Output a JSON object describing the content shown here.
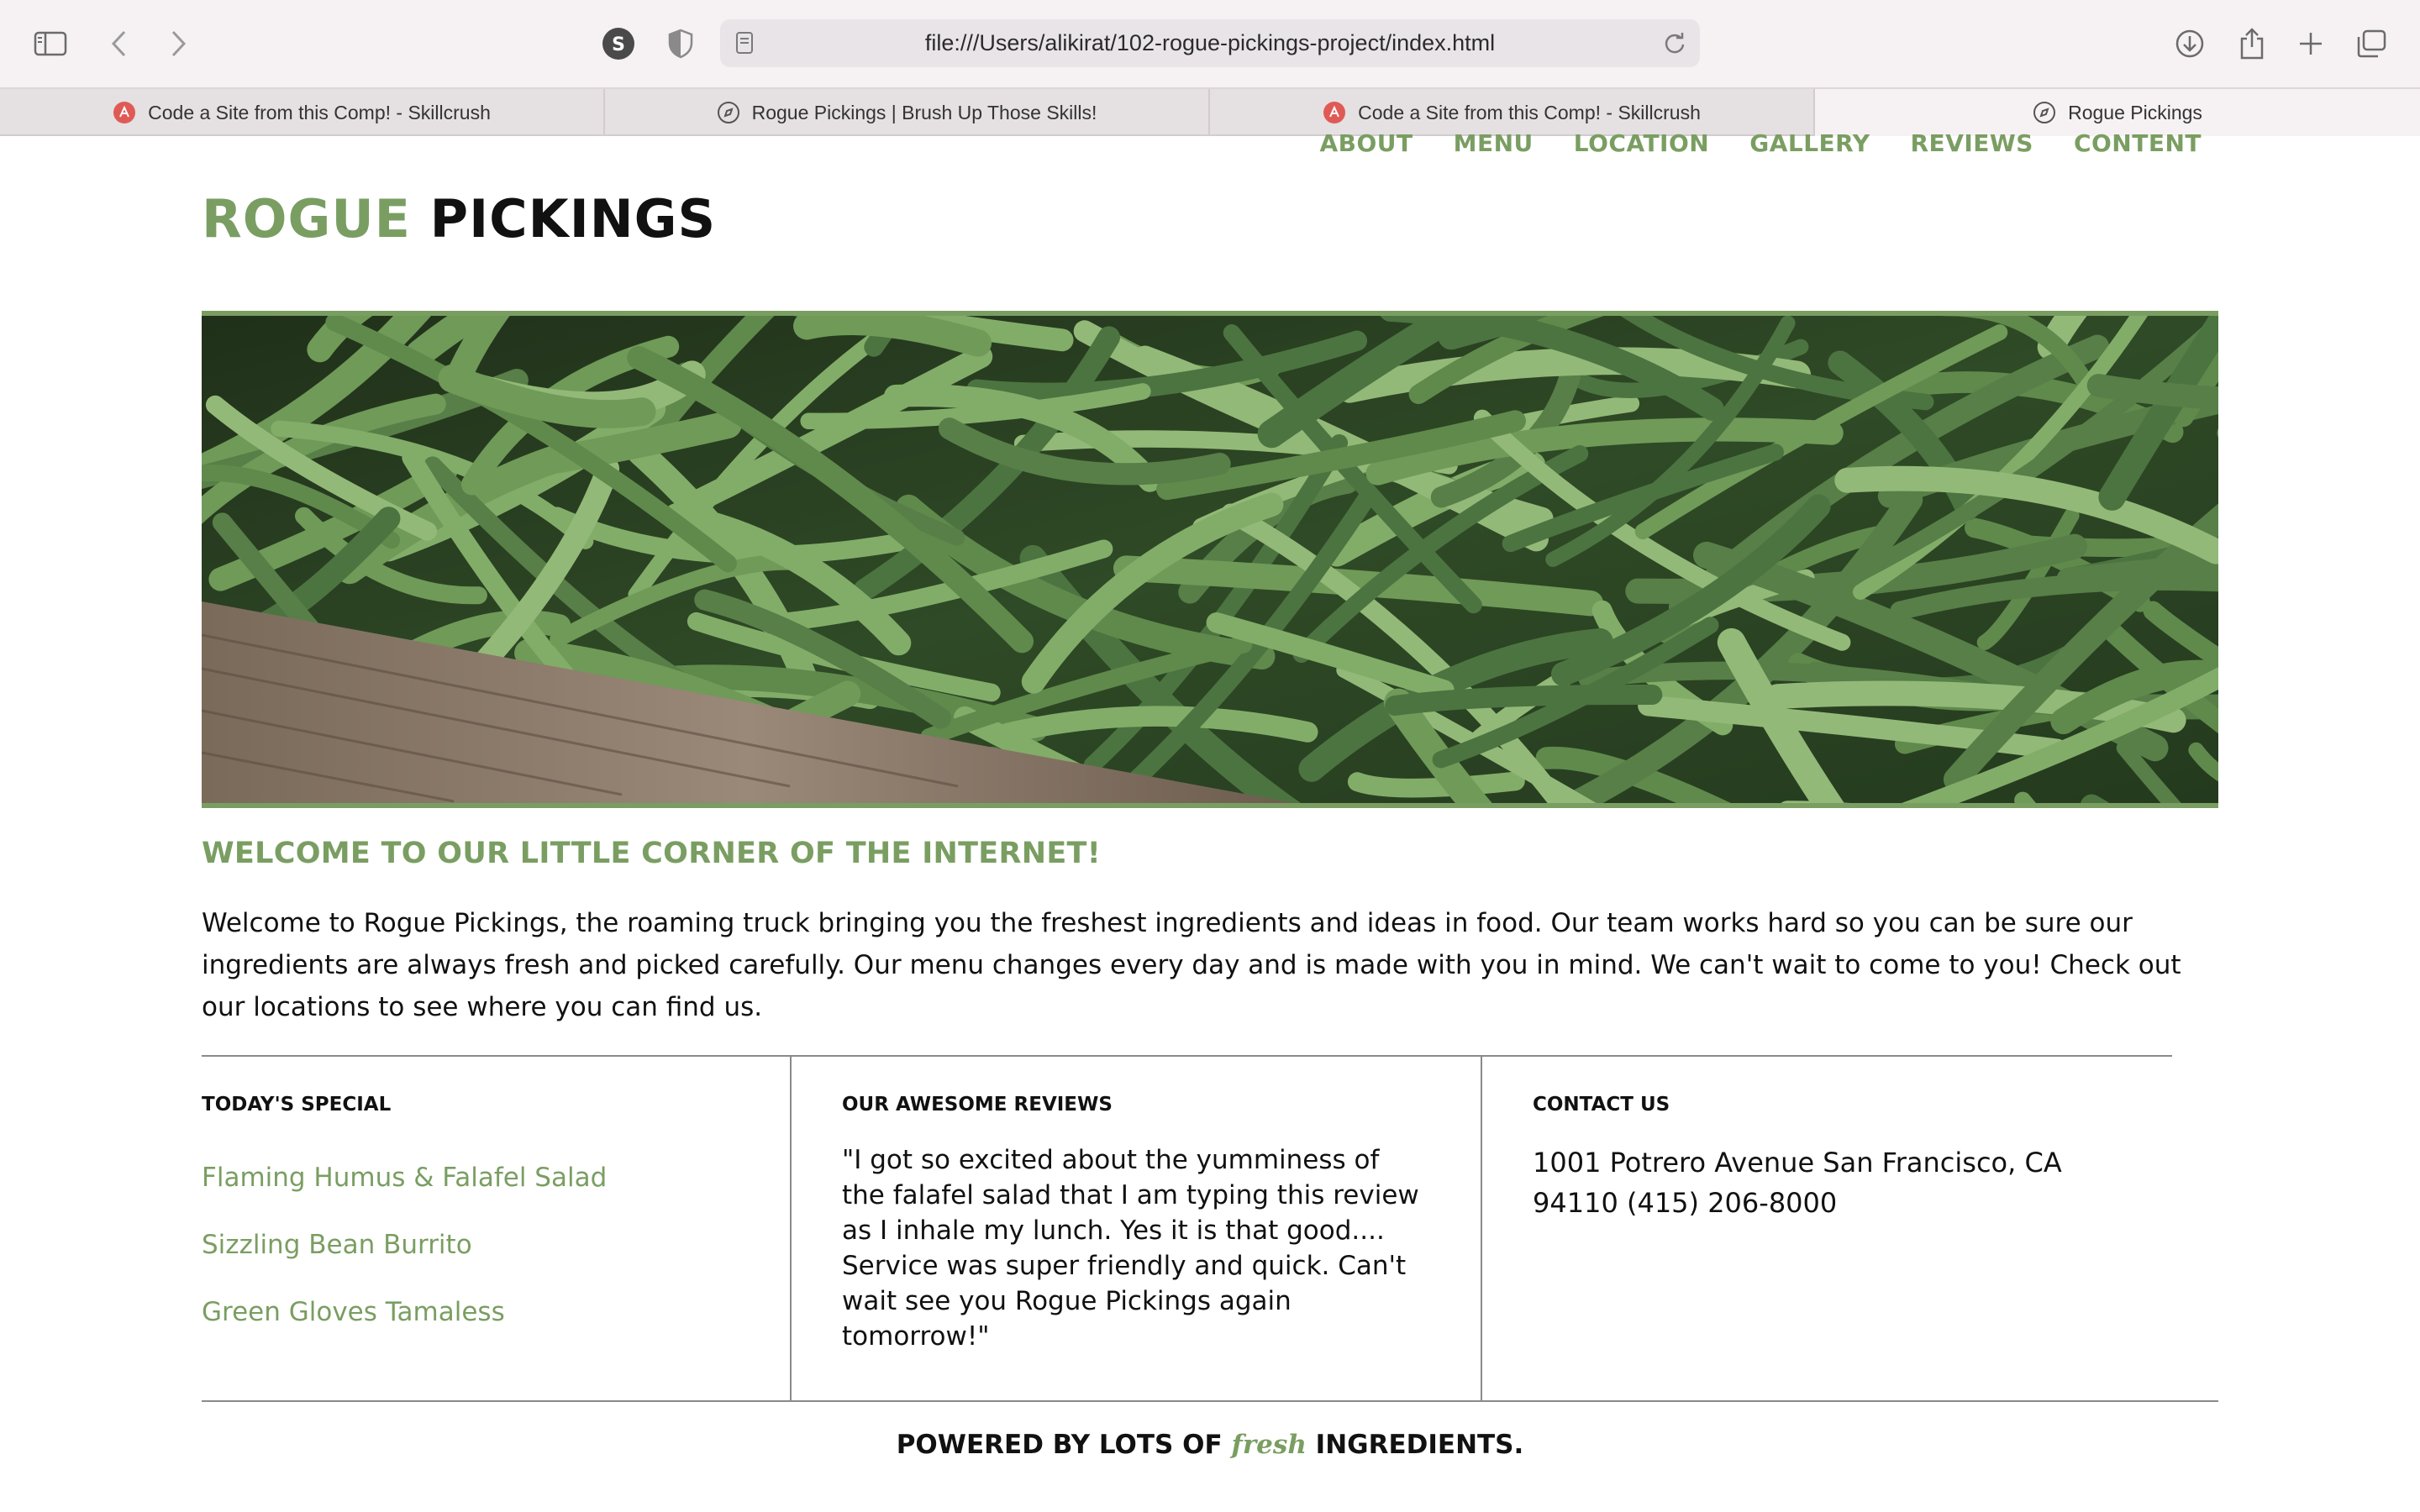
{
  "browser": {
    "url": "file:///Users/alikirat/102-rogue-pickings-project/index.html",
    "tabs": [
      {
        "label": "Code a Site from this Comp! - Skillcrush",
        "favicon": "skillcrush-icon",
        "active": false
      },
      {
        "label": "Rogue Pickings | Brush Up Those Skills!",
        "favicon": "compass-icon",
        "active": false
      },
      {
        "label": "Code a Site from this Comp! - Skillcrush",
        "favicon": "skillcrush-icon",
        "active": false
      },
      {
        "label": "Rogue Pickings",
        "favicon": "compass-icon",
        "active": true
      }
    ],
    "icons": [
      "sidebar-icon",
      "back-icon",
      "forward-icon",
      "extension-s-icon",
      "privacy-shield-icon",
      "page-icon",
      "reload-icon",
      "download-icon",
      "share-icon",
      "new-tab-icon",
      "tab-overview-icon"
    ]
  },
  "site": {
    "nav": [
      "ABOUT",
      "MENU",
      "LOCATION",
      "GALLERY",
      "REVIEWS",
      "CONTENT"
    ],
    "logo": {
      "first": "ROGUE",
      "second": "PICKINGS"
    },
    "welcome_heading": "WELCOME TO OUR LITTLE CORNER OF THE INTERNET!",
    "welcome_text": "Welcome to Rogue Pickings, the roaming truck bringing you the freshest ingredients and ideas in food. Our team works hard so you can be sure our ingredients are always fresh and picked carefully. Our menu changes every day and is made with you in mind. We can't wait to come to you! Check out our locations to see where you can find us.",
    "special": {
      "heading": "TODAY'S SPECIAL",
      "items": [
        "Flaming Humus & Falafel Salad",
        "Sizzling Bean Burrito",
        "Green Gloves Tamaless"
      ]
    },
    "reviews": {
      "heading": "OUR AWESOME REVIEWS",
      "quote": "\"I got so excited about the yumminess of the falafel salad that I am typing this review as I inhale my lunch. Yes it is that good.... Service was super friendly and quick. Can't wait see you Rogue Pickings again tomorrow!\""
    },
    "contact": {
      "heading": "CONTACT US",
      "address": "1001 Potrero Avenue San Francisco, CA 94110 (415) 206-8000"
    },
    "footer": {
      "before": "POWERED BY LOTS OF",
      "em": "fresh",
      "after": "INGREDIENTS."
    },
    "colors": {
      "accent": "#7a9e62",
      "text": "#111111",
      "rule": "#8a8a8a"
    }
  }
}
